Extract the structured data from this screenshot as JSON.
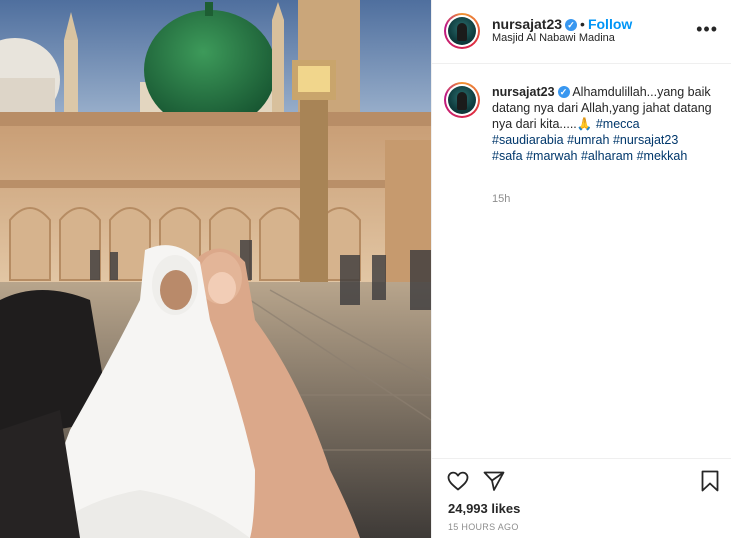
{
  "post": {
    "username": "nursajat23",
    "verified_symbol": "✓",
    "dot": "•",
    "follow_label": "Follow",
    "location": "Masjid Al Nabawi Madina",
    "more_label": "•••"
  },
  "caption": {
    "username": "nursajat23",
    "text": "Alhamdulillah...yang baik datang nya dari Allah,yang jahat datang nya dari kita.....",
    "emoji": "🙏",
    "hashtags": [
      "#mecca",
      "#saudiarabia",
      "#umrah",
      "#nursajat23",
      "#safa",
      "#marwah",
      "#alharam",
      "#mekkah"
    ],
    "time": "15h"
  },
  "actions": {
    "icons": [
      "heart-icon",
      "share-icon",
      "bookmark-icon"
    ],
    "likes_count": "24,993",
    "likes_label": "likes",
    "timestamp": "15 HOURS AGO"
  },
  "colors": {
    "link": "#0095f6",
    "hashtag": "#00376b",
    "verified": "#3897f0",
    "muted": "#8e8e8e"
  }
}
